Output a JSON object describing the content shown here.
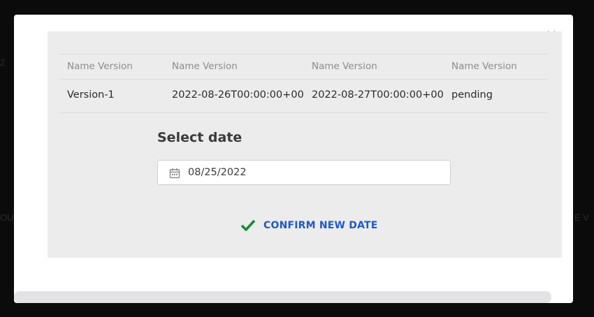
{
  "background": {
    "fragments": [
      "2",
      "OU",
      "E V"
    ]
  },
  "modal": {
    "close_icon": "close-icon",
    "table": {
      "headers": [
        "Name Version",
        "Name Version",
        "Name Version",
        "Name Version"
      ],
      "rows": [
        [
          "Version-1",
          "2022-08-26T00:00:00+00",
          "2022-08-27T00:00:00+00",
          "pending"
        ]
      ]
    },
    "select_date": {
      "title": "Select date",
      "value": "08/25/2022",
      "icon": "calendar-icon"
    },
    "confirm": {
      "label": "CONFIRM NEW DATE",
      "icon": "checkmark-icon",
      "icon_color": "#1a8a3a",
      "label_color": "#1f59c7"
    }
  },
  "colors": {
    "backdrop": "#0b0b0b",
    "modal": "#ffffff",
    "panel": "#ececec"
  }
}
